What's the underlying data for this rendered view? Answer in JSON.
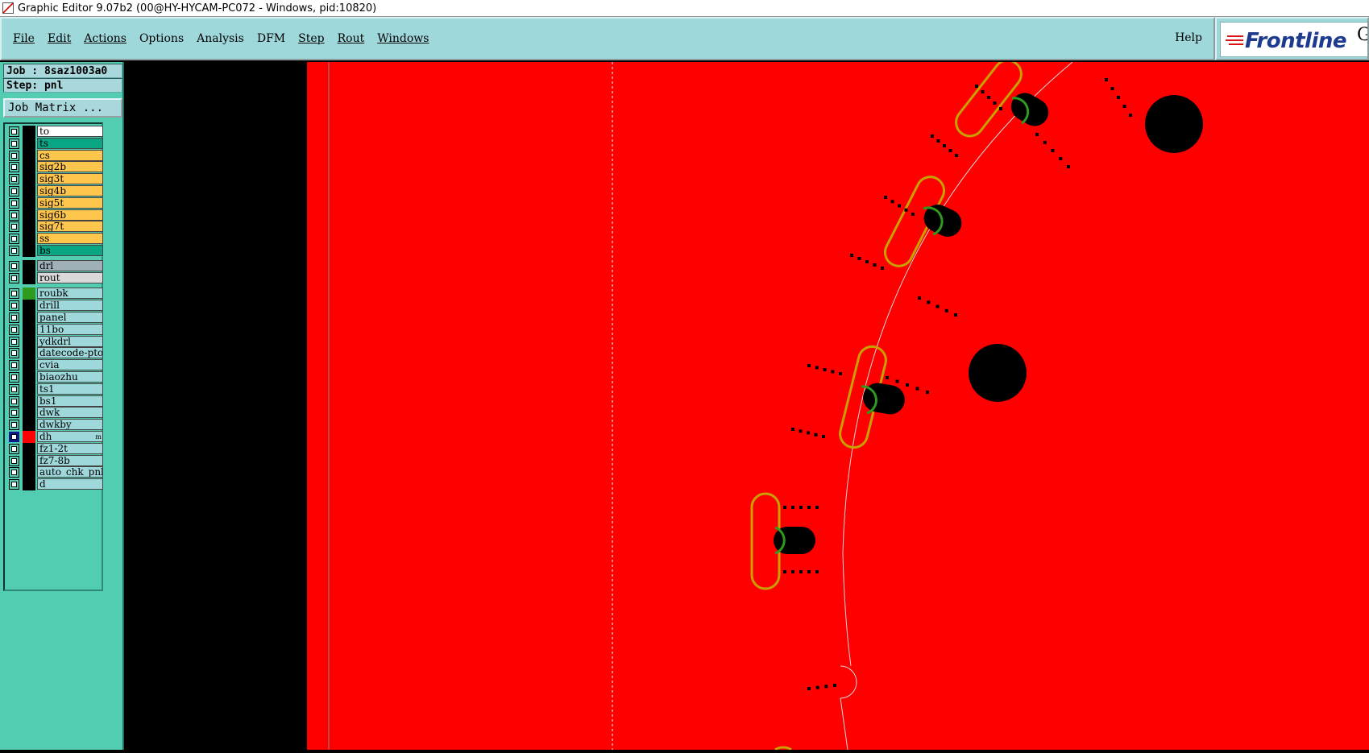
{
  "window": {
    "title": "Graphic Editor 9.07b2 (00@HY-HYCAM-PC072 - Windows, pid:10820)"
  },
  "menubar": {
    "items": [
      "File",
      "Edit",
      "Actions",
      "Options",
      "Analysis",
      "DFM",
      "Step",
      "Rout",
      "Windows"
    ],
    "underlined": [
      true,
      true,
      true,
      false,
      false,
      false,
      true,
      true,
      true
    ],
    "help": "Help"
  },
  "logo": {
    "text": "Frontline",
    "suffix": "Ge"
  },
  "job": {
    "label": "Job : 8saz1003a0",
    "step": "Step: pnl",
    "matrix_button": "Job Matrix ..."
  },
  "layer_groups": [
    [
      {
        "name": "to",
        "color": "#ffffff"
      },
      {
        "name": "ts",
        "color": "#0aa583"
      },
      {
        "name": "cs",
        "color": "#ffc64d"
      },
      {
        "name": "sig2b",
        "color": "#ffc64d"
      },
      {
        "name": "sig3t",
        "color": "#ffc64d"
      },
      {
        "name": "sig4b",
        "color": "#ffc64d"
      },
      {
        "name": "sig5t",
        "color": "#ffc64d"
      },
      {
        "name": "sig6b",
        "color": "#ffc64d"
      },
      {
        "name": "sig7t",
        "color": "#ffc64d"
      },
      {
        "name": "ss",
        "color": "#ffc64d"
      },
      {
        "name": "bs",
        "color": "#0aa583"
      }
    ],
    [
      {
        "name": "drl",
        "color": "#9fb0b7"
      },
      {
        "name": "rout",
        "color": "#d9d9d9"
      }
    ],
    [
      {
        "name": "roubk",
        "color": "#9ed8db",
        "swatch": "#2f9a20"
      },
      {
        "name": "drill",
        "color": "#9ed8db"
      },
      {
        "name": "panel",
        "color": "#9ed8db"
      },
      {
        "name": "11bo",
        "color": "#9ed8db"
      },
      {
        "name": "ydkdrl",
        "color": "#9ed8db"
      },
      {
        "name": "datecode-pto",
        "color": "#9ed8db"
      },
      {
        "name": "cvia",
        "color": "#9ed8db"
      },
      {
        "name": "biaozhu",
        "color": "#9ed8db"
      },
      {
        "name": "ts1",
        "color": "#9ed8db"
      },
      {
        "name": "bs1",
        "color": "#9ed8db"
      },
      {
        "name": "dwk",
        "color": "#9ed8db"
      },
      {
        "name": "dwkby",
        "color": "#9ed8db"
      },
      {
        "name": "dh",
        "color": "#9ed8db",
        "swatch": "#ff0000",
        "active": true,
        "flag": "m"
      },
      {
        "name": "fz1-2t",
        "color": "#9ed8db"
      },
      {
        "name": "fz7-8b",
        "color": "#9ed8db"
      },
      {
        "name": "auto_chk_pnl",
        "color": "#9ed8db"
      },
      {
        "name": "d",
        "color": "#9ed8db"
      }
    ]
  ],
  "colors": {
    "board_fill": "#ff0000",
    "outline_pad": "#c8a000",
    "ring": "#2f9a20",
    "background": "#000000"
  }
}
